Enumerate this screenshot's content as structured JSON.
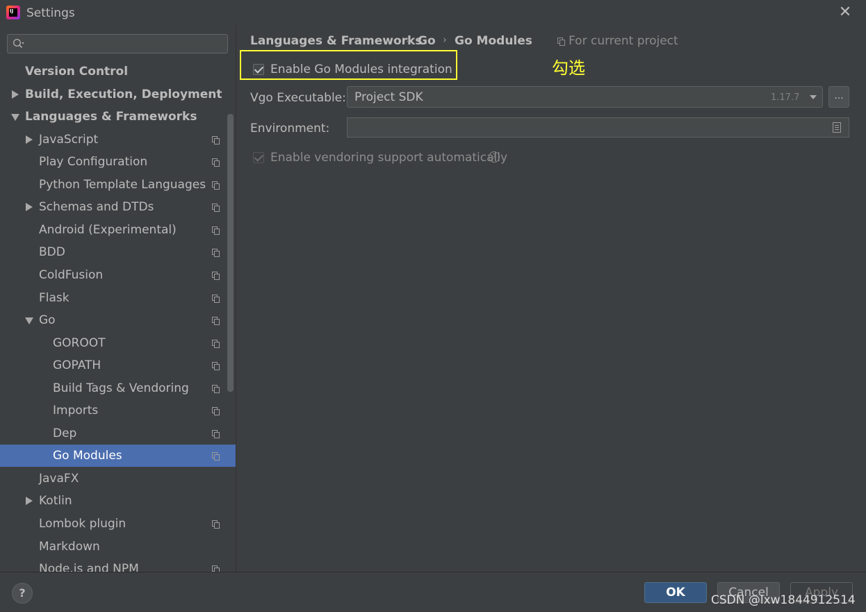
{
  "window": {
    "title": "Settings",
    "logo_text": "IJ"
  },
  "sidebar": {
    "search_placeholder": "",
    "items": [
      {
        "label": "Version Control",
        "bold": true,
        "indent": 0,
        "arrow": "none",
        "project_icon": false
      },
      {
        "label": "Build, Execution, Deployment",
        "bold": true,
        "indent": 0,
        "arrow": "right",
        "project_icon": false
      },
      {
        "label": "Languages & Frameworks",
        "bold": true,
        "indent": 0,
        "arrow": "down",
        "project_icon": false
      },
      {
        "label": "JavaScript",
        "indent": 1,
        "arrow": "right",
        "project_icon": true
      },
      {
        "label": "Play Configuration",
        "indent": 1,
        "arrow": "none",
        "project_icon": true
      },
      {
        "label": "Python Template Languages",
        "indent": 1,
        "arrow": "none",
        "project_icon": true
      },
      {
        "label": "Schemas and DTDs",
        "indent": 1,
        "arrow": "right",
        "project_icon": true
      },
      {
        "label": "Android (Experimental)",
        "indent": 1,
        "arrow": "none",
        "project_icon": true
      },
      {
        "label": "BDD",
        "indent": 1,
        "arrow": "none",
        "project_icon": true
      },
      {
        "label": "ColdFusion",
        "indent": 1,
        "arrow": "none",
        "project_icon": true
      },
      {
        "label": "Flask",
        "indent": 1,
        "arrow": "none",
        "project_icon": true
      },
      {
        "label": "Go",
        "indent": 1,
        "arrow": "down",
        "project_icon": true
      },
      {
        "label": "GOROOT",
        "indent": 2,
        "arrow": "none",
        "project_icon": true
      },
      {
        "label": "GOPATH",
        "indent": 2,
        "arrow": "none",
        "project_icon": true
      },
      {
        "label": "Build Tags & Vendoring",
        "indent": 2,
        "arrow": "none",
        "project_icon": true
      },
      {
        "label": "Imports",
        "indent": 2,
        "arrow": "none",
        "project_icon": true
      },
      {
        "label": "Dep",
        "indent": 2,
        "arrow": "none",
        "project_icon": true
      },
      {
        "label": "Go Modules",
        "indent": 2,
        "arrow": "none",
        "project_icon": true,
        "selected": true
      },
      {
        "label": "JavaFX",
        "indent": 1,
        "arrow": "none",
        "project_icon": false
      },
      {
        "label": "Kotlin",
        "indent": 1,
        "arrow": "right",
        "project_icon": false
      },
      {
        "label": "Lombok plugin",
        "indent": 1,
        "arrow": "none",
        "project_icon": true
      },
      {
        "label": "Markdown",
        "indent": 1,
        "arrow": "none",
        "project_icon": false
      },
      {
        "label": "Node.js and NPM",
        "indent": 1,
        "arrow": "none",
        "project_icon": true
      }
    ]
  },
  "breadcrumb": {
    "items": [
      "Languages & Frameworks",
      "Go",
      "Go Modules"
    ],
    "separator": "›",
    "scope_label": "For current project"
  },
  "settings": {
    "enable_modules": {
      "label": "Enable Go Modules integration",
      "checked": true
    },
    "annotation": "勾选",
    "vgo_executable": {
      "label": "Vgo Executable:",
      "value": "Project SDK",
      "version": "1.17.7",
      "browse_label": "..."
    },
    "environment": {
      "label": "Environment:",
      "value": ""
    },
    "vendoring": {
      "label": "Enable vendoring support automatically",
      "checked": true,
      "enabled": false,
      "help": "?"
    }
  },
  "footer": {
    "help_label": "?",
    "ok_label": "OK",
    "cancel_label": "Cancel",
    "apply_label": "Apply",
    "watermark": "CSDN @lxw1844912514"
  },
  "colors": {
    "background": "#3c3f41",
    "selection": "#4b6eaf",
    "highlight": "#ffff33",
    "ok_button": "#365880"
  }
}
